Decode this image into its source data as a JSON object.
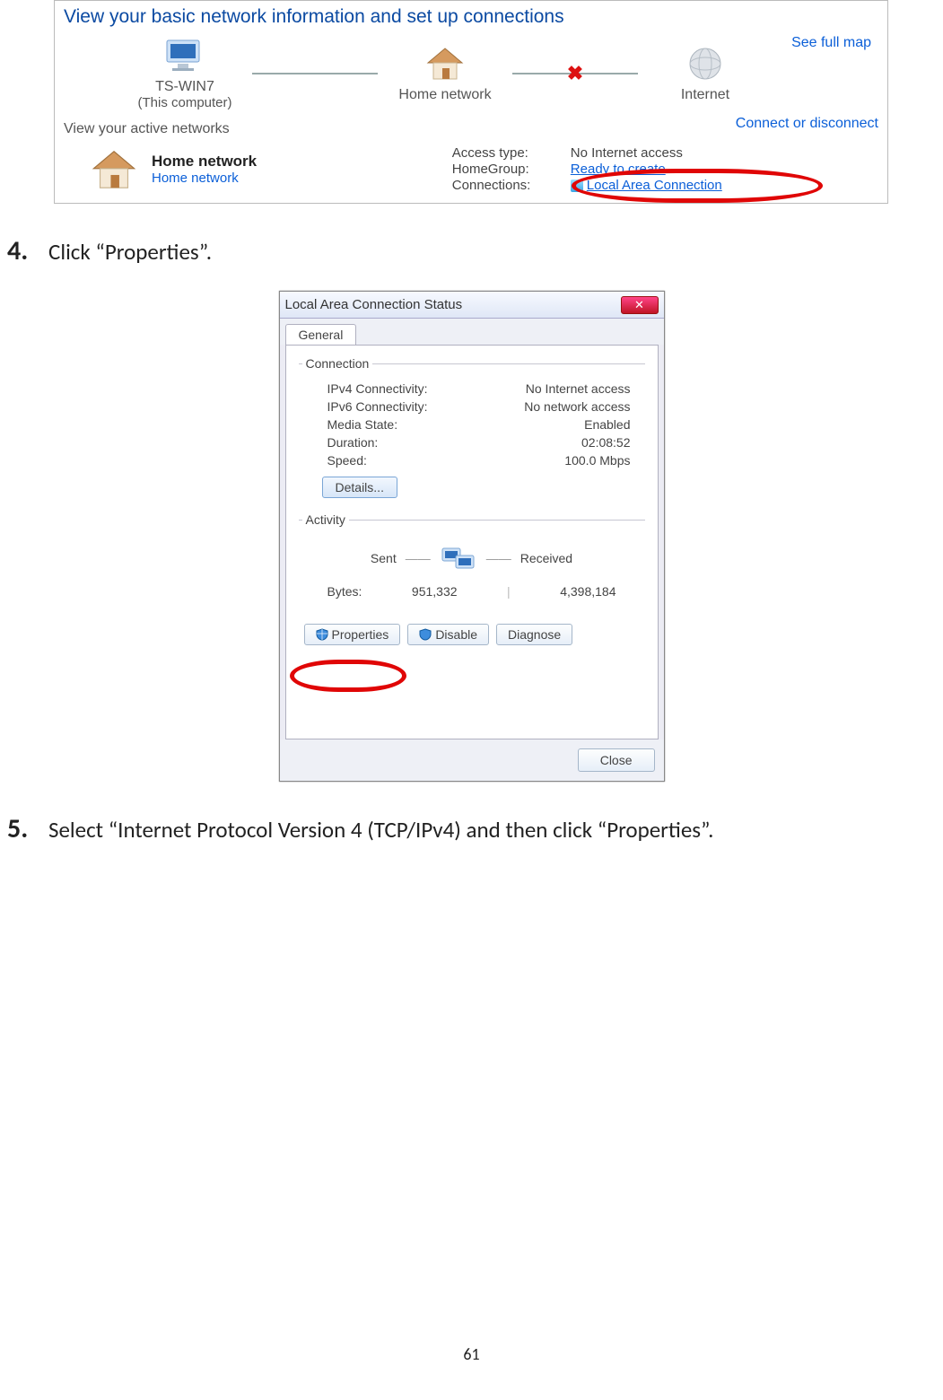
{
  "page_number": "61",
  "fig1": {
    "title": "View your basic network information and set up connections",
    "see_full_map": "See full map",
    "nodes": {
      "computer": {
        "name": "TS-WIN7",
        "sub": "(This computer)"
      },
      "home": {
        "name": "Home network"
      },
      "internet": {
        "name": "Internet"
      }
    },
    "active_section_label": "View your active networks",
    "connect_link": "Connect or disconnect",
    "active": {
      "name": "Home network",
      "type": "Home network",
      "access_type_label": "Access type:",
      "access_type_value": "No Internet access",
      "homegroup_label": "HomeGroup:",
      "homegroup_value": "Ready to create",
      "connections_label": "Connections:",
      "connections_value": "Local Area Connection"
    }
  },
  "step4": {
    "num": "4.",
    "text": "Click “Properties”."
  },
  "fig2": {
    "title": "Local Area Connection Status",
    "close_x": "✕",
    "tab_general": "General",
    "group_connection": "Connection",
    "rows": {
      "ipv4_k": "IPv4 Connectivity:",
      "ipv4_v": "No Internet access",
      "ipv6_k": "IPv6 Connectivity:",
      "ipv6_v": "No network access",
      "media_k": "Media State:",
      "media_v": "Enabled",
      "duration_k": "Duration:",
      "duration_v": "02:08:52",
      "speed_k": "Speed:",
      "speed_v": "100.0 Mbps"
    },
    "details_btn": "Details...",
    "group_activity": "Activity",
    "sent_label": "Sent",
    "received_label": "Received",
    "bytes_label": "Bytes:",
    "bytes_sent": "951,332",
    "bytes_recv": "4,398,184",
    "btn_properties": "Properties",
    "btn_disable": "Disable",
    "btn_diagnose": "Diagnose",
    "btn_close": "Close"
  },
  "step5": {
    "num": "5.",
    "text": "Select “Internet Protocol Version 4 (TCP/IPv4) and then click “Properties”."
  }
}
